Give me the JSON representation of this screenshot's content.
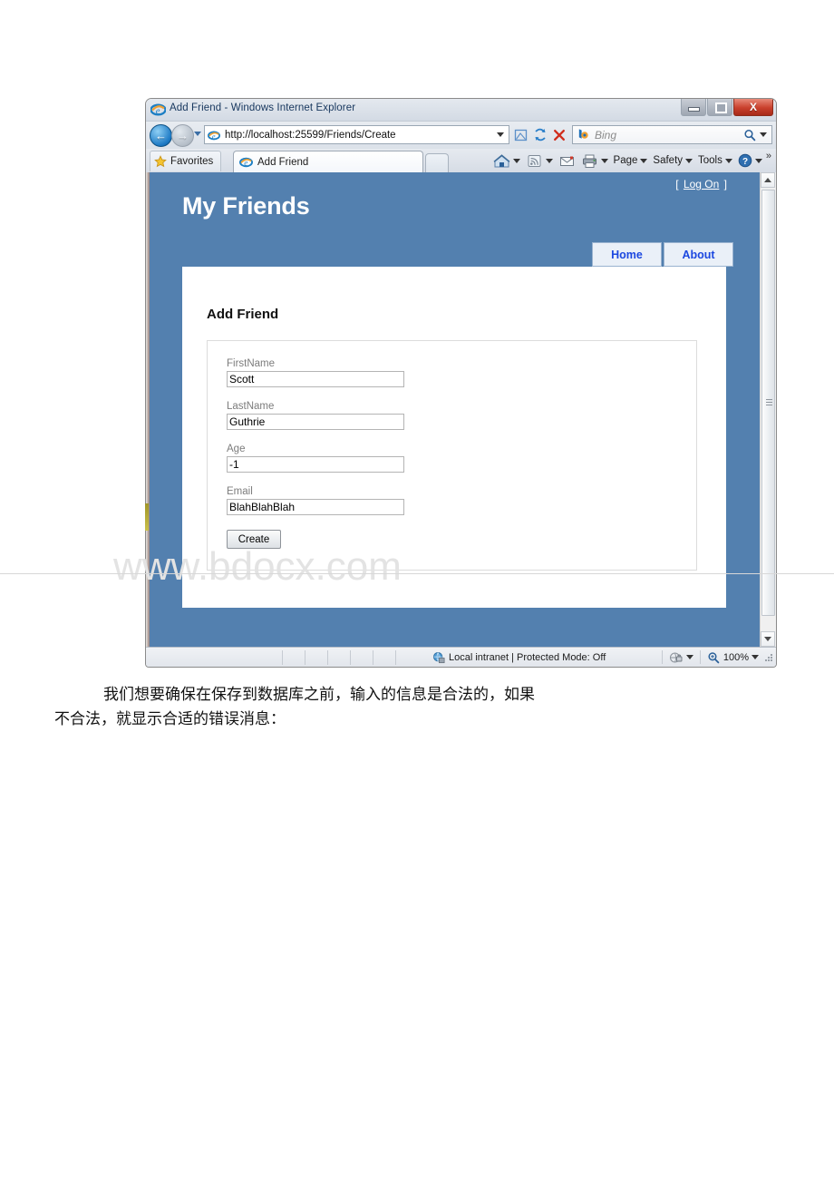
{
  "browser": {
    "title_bar": {
      "title": "Add Friend - Windows Internet Explorer",
      "ie_icon": "ie-logo-icon",
      "minimize_label": "",
      "maximize_label": "",
      "close_label": "X"
    },
    "nav_bar": {
      "back_icon": "back-arrow-icon",
      "back_glyph": "←",
      "forward_icon": "forward-arrow-icon",
      "forward_glyph": "→",
      "history_dropdown_icon": "chevron-down-icon",
      "url": "http://localhost:25599/Friends/Create",
      "url_favicon": "ie-page-icon",
      "url_dropdown_icon": "chevron-down-icon",
      "compat_view_icon": "compatibility-view-icon",
      "refresh_icon": "refresh-icon",
      "stop_icon": "stop-icon",
      "search": {
        "provider_icon": "bing-icon",
        "placeholder": "Bing",
        "value": "",
        "go_icon": "search-icon",
        "dropdown_icon": "chevron-down-icon"
      }
    },
    "tab_bar": {
      "favorites_label": "Favorites",
      "favorites_icon": "star-icon",
      "tab_label": "Add Friend",
      "tab_icon": "ie-page-icon",
      "new_tab_label": "",
      "command_bar": {
        "home_icon": "home-icon",
        "feeds_icon": "rss-feed-icon",
        "mail_icon": "mail-icon",
        "print_icon": "printer-icon",
        "page_label": "Page",
        "safety_label": "Safety",
        "tools_label": "Tools",
        "help_icon": "help-icon",
        "overflow_label": "»"
      }
    },
    "status_bar": {
      "zone_icon": "internet-zone-icon",
      "zone_text": "Local intranet | Protected Mode: Off",
      "privacy_icon": "privacy-report-icon",
      "privacy_dropdown_icon": "chevron-down-icon",
      "zoom_icon": "zoom-icon",
      "zoom_level": "100%",
      "zoom_dropdown_icon": "chevron-down-icon"
    },
    "scrollbar": {
      "up_arrow": "scroll-up-arrow-icon",
      "down_arrow": "scroll-down-arrow-icon"
    }
  },
  "webpage": {
    "header": {
      "logon_prefix": "[",
      "logon_label": "Log On",
      "logon_suffix": "]",
      "site_title": "My Friends"
    },
    "nav_tabs": [
      {
        "label": "Home"
      },
      {
        "label": "About"
      }
    ],
    "main": {
      "heading": "Add Friend",
      "fields": [
        {
          "label": "FirstName",
          "value": "Scott"
        },
        {
          "label": "LastName",
          "value": "Guthrie"
        },
        {
          "label": "Age",
          "value": "-1"
        },
        {
          "label": "Email",
          "value": "BlahBlahBlah"
        }
      ],
      "submit_label": "Create"
    },
    "colors": {
      "header_blue": "#5380af",
      "nav_tab_bg": "#eaf0f8",
      "nav_tab_text": "#1c48e0",
      "panel_bg": "#ffffff",
      "label_gray": "#7c7c7c"
    }
  },
  "document": {
    "watermark": "www.bdocx.com",
    "paragraph_line1": "我们想要确保在保存到数据库之前，输入的信息是合法的，如果",
    "paragraph_line2": "不合法，就显示合适的错误消息："
  }
}
